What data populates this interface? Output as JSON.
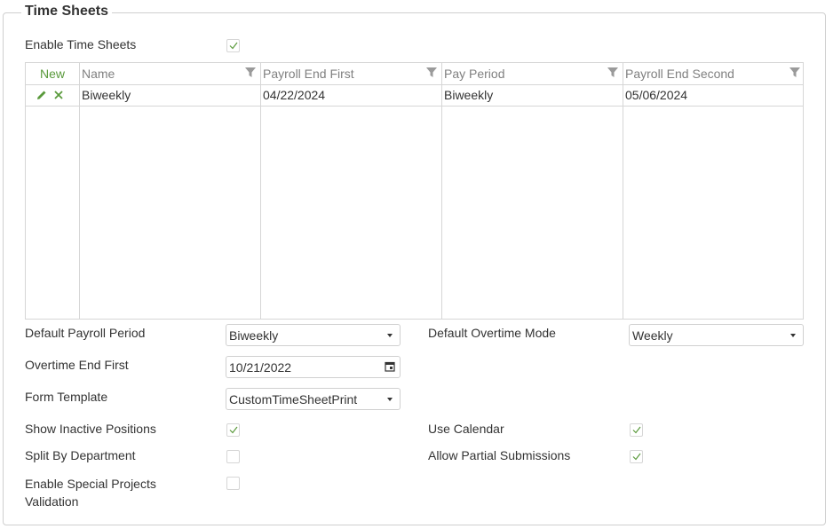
{
  "section": {
    "title": "Time Sheets"
  },
  "enable_time_sheets": {
    "label": "Enable Time Sheets",
    "checked": true
  },
  "grid": {
    "new_label": "New",
    "columns": [
      "Name",
      "Payroll End First",
      "Pay Period",
      "Payroll End Second"
    ],
    "rows": [
      {
        "name": "Biweekly",
        "payroll_end_first": "04/22/2024",
        "pay_period": "Biweekly",
        "payroll_end_second": "05/06/2024"
      }
    ]
  },
  "form": {
    "default_payroll_period": {
      "label": "Default Payroll Period",
      "value": "Biweekly"
    },
    "default_overtime_mode": {
      "label": "Default Overtime Mode",
      "value": "Weekly"
    },
    "overtime_end_first": {
      "label": "Overtime End First",
      "value": "10/21/2022"
    },
    "form_template": {
      "label": "Form Template",
      "value": "CustomTimeSheetPrint"
    },
    "show_inactive_positions": {
      "label": "Show Inactive Positions",
      "checked": true
    },
    "use_calendar": {
      "label": "Use Calendar",
      "checked": true
    },
    "split_by_department": {
      "label": "Split By Department",
      "checked": false
    },
    "allow_partial_submissions": {
      "label": "Allow Partial Submissions",
      "checked": true
    },
    "enable_special_projects_validation": {
      "label_line1": "Enable Special Projects",
      "label_line2": "Validation",
      "checked": false
    }
  },
  "colors": {
    "accent": "#5a9a3c",
    "border": "#d6d6d6",
    "header_text": "#808080"
  }
}
